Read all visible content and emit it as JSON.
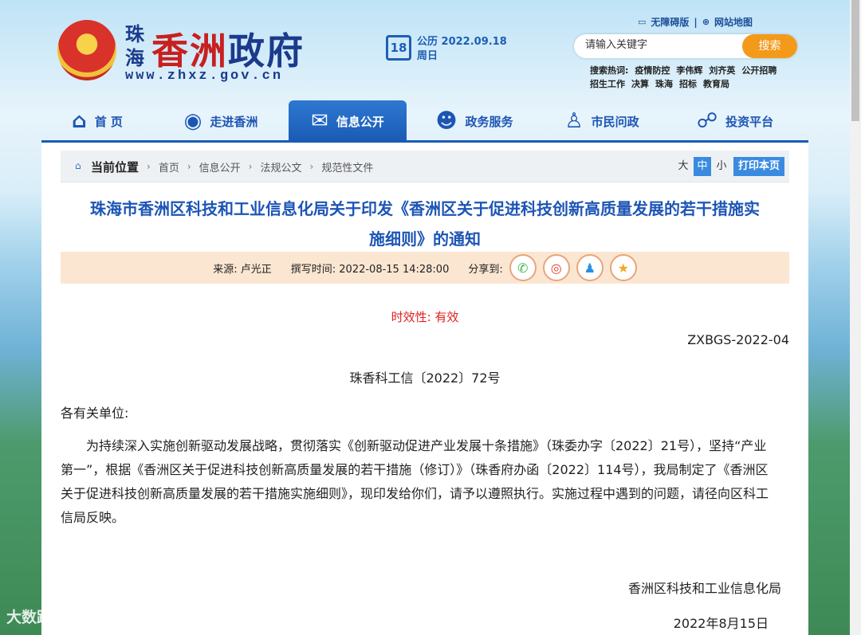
{
  "header": {
    "logo_side": "珠海",
    "logo_main_a": "香洲",
    "logo_main_b": "政府",
    "url": "www.zhxz.gov.cn",
    "date_day": "18",
    "date_line1": "公历 2022.09.18",
    "date_line2": "周日",
    "accessibility": "无障碍版",
    "sitemap": "网站地图",
    "search_placeholder": "请输入关键字",
    "search_button": "搜索",
    "hot_label": "搜索热词:",
    "hot_words": [
      "疫情防控",
      "李伟辉",
      "刘齐英",
      "公开招聘",
      "招生工作",
      "决算",
      "珠海",
      "招标",
      "教育局"
    ]
  },
  "nav": [
    {
      "label": "首 页",
      "icon": "home-icon",
      "glyph": "⌂"
    },
    {
      "label": "走进香洲",
      "icon": "location-icon",
      "glyph": "◉"
    },
    {
      "label": "信息公开",
      "icon": "mail-open-icon",
      "glyph": "✉"
    },
    {
      "label": "政务服务",
      "icon": "people-icon",
      "glyph": "☻"
    },
    {
      "label": "市民问政",
      "icon": "person-icon",
      "glyph": "♙"
    },
    {
      "label": "投资平台",
      "icon": "handshake-icon",
      "glyph": "☍"
    }
  ],
  "breadcrumb": {
    "current": "当前位置",
    "items": [
      "首页",
      "信息公开",
      "法规公文",
      "规范性文件"
    ]
  },
  "fontsize": {
    "large": "大",
    "medium": "中",
    "small": "小",
    "print": "打印本页"
  },
  "article": {
    "title_line1": "珠海市香洲区科技和工业信息化局关于印发《香洲区关于促进科技创新高质量发展的若干措施实",
    "title_line2": "施细则》的通知",
    "source": "来源: 卢光正",
    "time": "撰写时间: 2022-08-15 14:28:00",
    "share": "分享到:",
    "validity": "时效性: 有效",
    "code": "ZXBGS-2022-04",
    "doc_no": "珠香科工信〔2022〕72号",
    "greeting": "各有关单位:",
    "body": "为持续深入实施创新驱动发展战略，贯彻落实《创新驱动促进产业发展十条措施》（珠委办字〔2022〕21号），坚持“产业第一”，根据《香洲区关于促进科技创新高质量发展的若干措施（修订）》（珠香府办函〔2022〕114号），我局制定了《香洲区关于促进科技创新高质量发展的若干措施实施细则》，现印发给你们，请予以遵照执行。实施过程中遇到的问题，请径向区科工信局反映。",
    "signature": "香洲区科技和工业信息化局",
    "sign_date": "2022年8月15日"
  },
  "watermark": "大数跨境"
}
